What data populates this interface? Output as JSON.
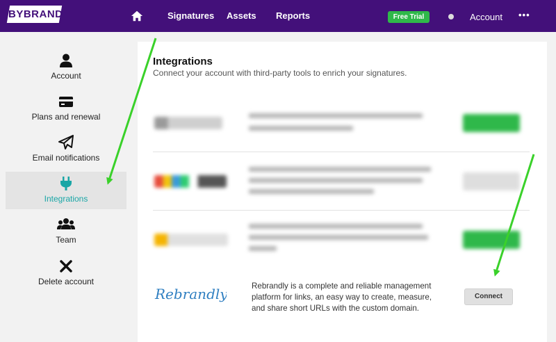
{
  "brand": {
    "logo_text": "BYBRAND"
  },
  "nav": {
    "home_icon": "home-icon",
    "items": [
      {
        "label": "Signatures"
      },
      {
        "label": "Assets"
      },
      {
        "label": "Reports"
      }
    ],
    "badge": "Free Trial",
    "account": "Account",
    "more": "•••"
  },
  "sidebar": {
    "items": [
      {
        "label": "Account",
        "icon": "user-icon"
      },
      {
        "label": "Plans and renewal",
        "icon": "credit-card-icon"
      },
      {
        "label": "Email notifications",
        "icon": "paper-plane-icon"
      },
      {
        "label": "Integrations",
        "icon": "plug-icon",
        "active": true
      },
      {
        "label": "Team",
        "icon": "users-icon"
      },
      {
        "label": "Delete account",
        "icon": "x-icon"
      }
    ]
  },
  "main": {
    "title": "Integrations",
    "subtitle": "Connect your account with third-party tools to enrich your signatures.",
    "rebrandly": {
      "logo_text": "Rebrandly",
      "description": "Rebrandly is a complete and reliable management platform for links, an easy way to create, measure, and share short URLs with the custom domain.",
      "button": "Connect"
    }
  },
  "colors": {
    "topbar": "#43107a",
    "trial_badge": "#2fb84a",
    "active_item": "#19a6a6",
    "arrow": "#3ad12a"
  }
}
